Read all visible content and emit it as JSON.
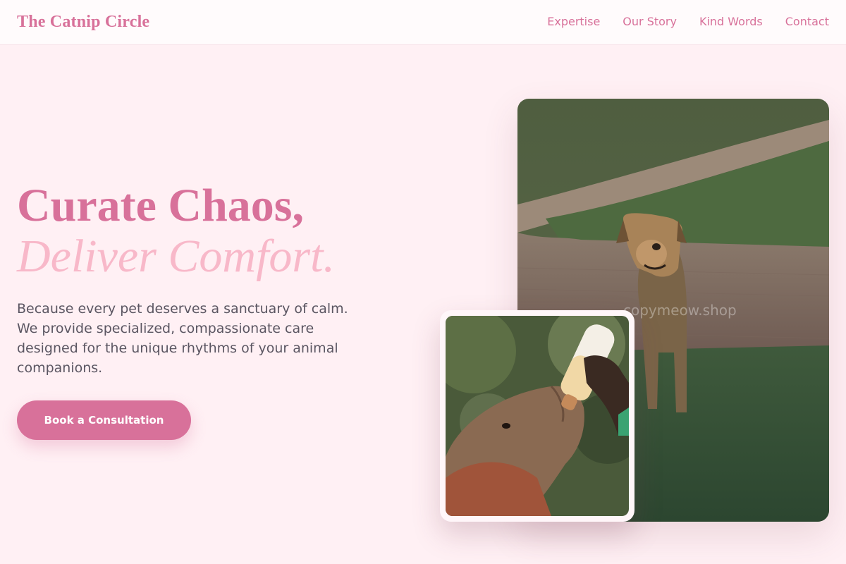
{
  "brand": {
    "name": "The Catnip Circle"
  },
  "nav": {
    "items": [
      "Expertise",
      "Our Story",
      "Kind Words",
      "Contact"
    ]
  },
  "hero": {
    "headline_line1": "Curate Chaos,",
    "headline_line2": "Deliver Comfort.",
    "lede": "Because every pet deserves a sanctuary of calm. We provide specialized, compassionate care designed for the unique rhythms of your animal companions.",
    "cta_label": "Book a Consultation"
  },
  "images": {
    "main_alt": "Dog sitting on grass beside a brick path",
    "main_watermark": "copymeow.shop",
    "small_alt": "Baby elephant being fed from a bottle"
  },
  "colors": {
    "accent": "#d8719a",
    "accent_light": "#f8b8c9",
    "background": "#fff0f4",
    "text": "#5b5662"
  }
}
